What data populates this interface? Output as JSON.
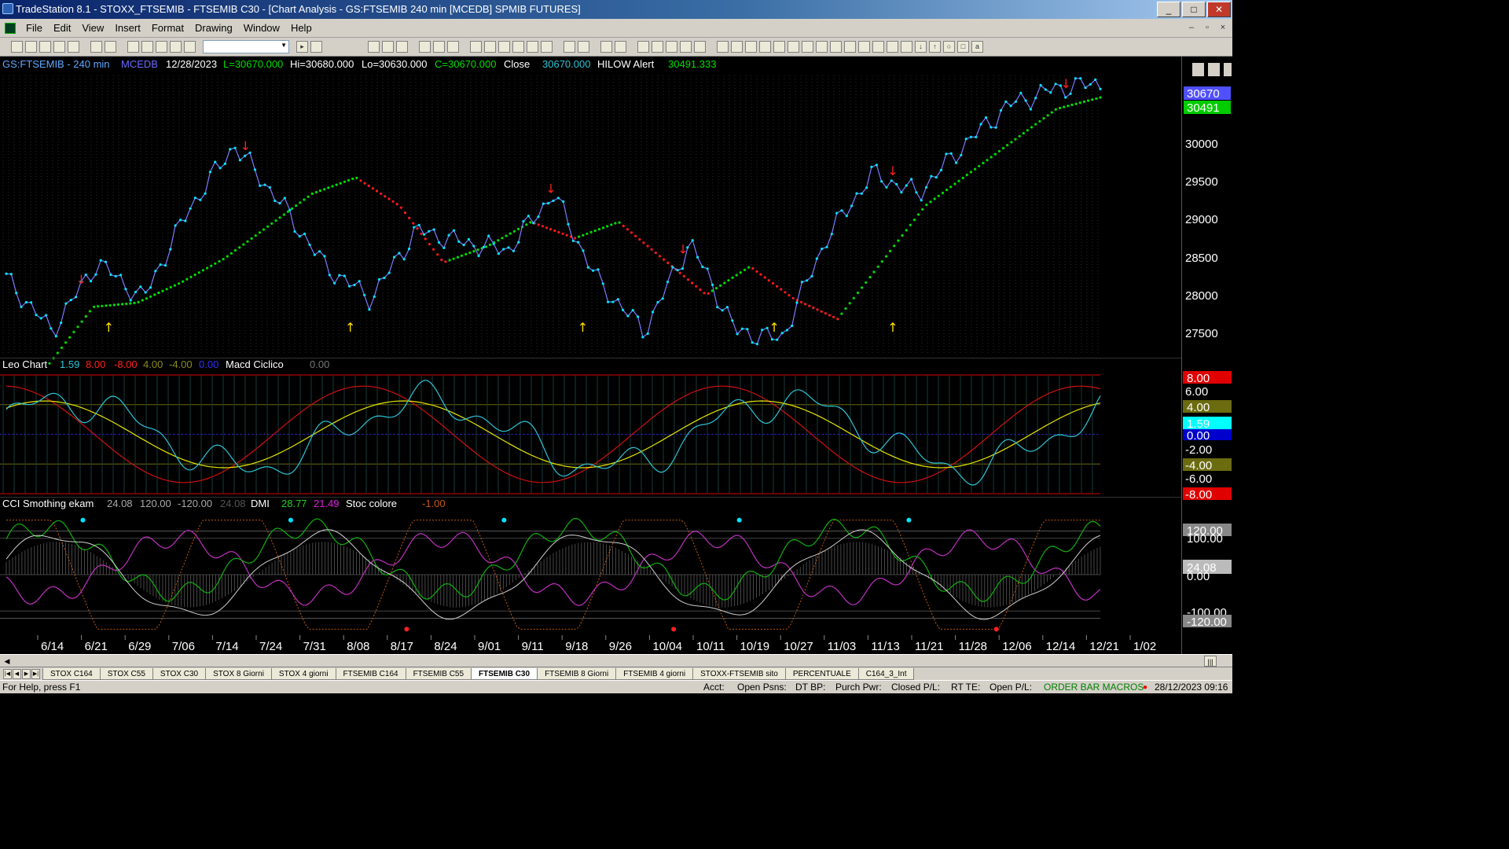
{
  "window": {
    "title": "TradeStation 8.1 - STOXX_FTSEMIB - FTSEMIB C30 - [Chart Analysis - GS:FTSEMIB  240 min  [MCEDB] SPMIB FUTURES]",
    "buttons": [
      "_",
      "□",
      "✕"
    ]
  },
  "menu": [
    "File",
    "Edit",
    "View",
    "Insert",
    "Format",
    "Drawing",
    "Window",
    "Help"
  ],
  "toolbar": {
    "select_value": ""
  },
  "price_pane": {
    "header": {
      "symbol": "GS:FTSEMIB - 240 min",
      "feed": "MCEDB",
      "date": "12/28/2023",
      "low_open": "L=30670.000",
      "hi": "Hi=30680.000",
      "lo": "Lo=30630.000",
      "close_val": "C=30670.000",
      "close_label": "Close",
      "close_num": "30670.000",
      "hilow_label": "HILOW Alert",
      "hilow_num": "30491.333"
    },
    "axis": {
      "ticks": [
        "30000",
        "29500",
        "29000",
        "28500",
        "28000",
        "27500"
      ],
      "last_close": "30670",
      "last_hilow": "30491"
    }
  },
  "osc_pane": {
    "header": {
      "name": "Leo Chart",
      "v1": "1.59",
      "v2": "8.00",
      "v3": "-8.00",
      "v4": "4.00",
      "v5": "-4.00",
      "v6": "0.00",
      "macd": "Macd Ciclico",
      "macd_val": "0.00"
    },
    "axis": {
      "t8": "8.00",
      "t6": "6.00",
      "t4": "4.00",
      "tv": "1.59",
      "t0": "0.00",
      "tm2": "-2.00",
      "tm4": "-4.00",
      "tm6": "-6.00",
      "tm8": "-8.00"
    }
  },
  "cci_pane": {
    "header": {
      "name": "CCI Smothing ekam",
      "v1": "24.08",
      "v2": "120.00",
      "v3": "-120.00",
      "v4": "24.08",
      "dmi": "DMI",
      "dmi1": "28.77",
      "dmi2": "21.49",
      "stoc": "Stoc colore",
      "stoc_val": "-1.00"
    },
    "axis": {
      "t120": "120.00",
      "t100": "100.00",
      "tcur": "24.08",
      "t0": "0.00",
      "tm100": "-100.00",
      "tm120": "-120.00"
    }
  },
  "x_axis": [
    "6/14",
    "6/21",
    "6/29",
    "7/06",
    "7/14",
    "7/24",
    "7/31",
    "8/08",
    "8/17",
    "8/24",
    "9/01",
    "9/11",
    "9/18",
    "9/26",
    "10/04",
    "10/11",
    "10/19",
    "10/27",
    "11/03",
    "11/13",
    "11/21",
    "11/28",
    "12/06",
    "12/14",
    "12/21",
    "1/02"
  ],
  "workspace_tabs": [
    "STOX C164",
    "STOX C55",
    "STOX  C30",
    "STOX  8 Giorni",
    "STOX 4 giorni",
    "FTSEMIB C164",
    "FTSEMIB C55",
    "FTSEMIB C30",
    "FTSEMIB  8 Giorni",
    "FTSEMIB  4 giorni",
    "STOXX-FTSEMIB sito",
    "PERCENTUALE",
    "C164_3_Int"
  ],
  "active_tab": "FTSEMIB C30",
  "status": {
    "help": "For Help, press F1",
    "acct": "Acct:",
    "open_psns": "Open Psns:",
    "dt_bp": "DT BP:",
    "purch_pwr": "Purch Pwr:",
    "closed_pl": "Closed P/L:",
    "rt_te": "RT TE:",
    "open_pl": "Open P/L:",
    "macros": "ORDER BAR  MACROS",
    "datetime": "28/12/2023 09:16"
  },
  "colors": {
    "price": "#7b7bff",
    "dots": "#00e5ff",
    "up_line": "#00dd00",
    "down_line": "#ff1a1a",
    "osc_cyan": "#2ec4d6",
    "osc_yellow": "#e6e600",
    "osc_red": "#d01010",
    "magenta": "#c030c0"
  },
  "chart_data": {
    "type": "line",
    "x": [
      "6/14",
      "6/21",
      "6/29",
      "7/06",
      "7/14",
      "7/24",
      "7/31",
      "8/08",
      "8/17",
      "8/24",
      "9/01",
      "9/11",
      "9/18",
      "9/26",
      "10/04",
      "10/11",
      "10/19",
      "10/27",
      "11/03",
      "11/13",
      "11/21",
      "11/28",
      "12/06",
      "12/14",
      "12/21"
    ],
    "series": [
      {
        "name": "Close",
        "values": [
          28250,
          27600,
          28450,
          28000,
          29100,
          29900,
          29200,
          28400,
          28000,
          28850,
          28700,
          28600,
          29300,
          28200,
          27600,
          28700,
          27600,
          27500,
          28750,
          29550,
          29300,
          29900,
          30400,
          30600,
          30670
        ]
      },
      {
        "name": "HILOW Alert",
        "values": [
          27200,
          27900,
          27950,
          28200,
          28500,
          28900,
          29300,
          29500,
          29150,
          28450,
          28650,
          28950,
          28750,
          28950,
          28500,
          28050,
          28400,
          28000,
          27750,
          28450,
          29150,
          29550,
          29950,
          30350,
          30491
        ]
      }
    ],
    "ylim": [
      27300,
      30900
    ]
  }
}
